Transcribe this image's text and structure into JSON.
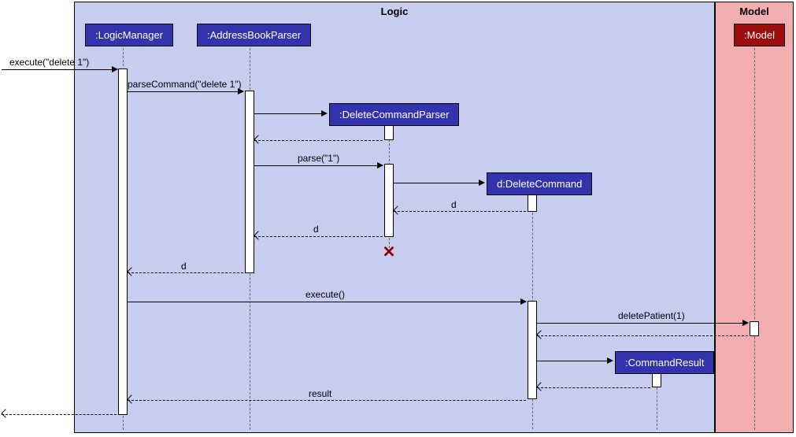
{
  "frames": {
    "logic": {
      "title": "Logic"
    },
    "model": {
      "title": "Model"
    }
  },
  "participants": {
    "logicManager": ":LogicManager",
    "addressBookParser": ":AddressBookParser",
    "deleteCommandParser": ":DeleteCommandParser",
    "deleteCommand": "d:DeleteCommand",
    "commandResult": ":CommandResult",
    "model": ":Model"
  },
  "messages": {
    "execute_delete1": "execute(\"delete 1\")",
    "parseCommand": "parseCommand(\"delete 1\")",
    "parse1": "parse(\"1\")",
    "d_return1": "d",
    "d_return2": "d",
    "d_return3": "d",
    "execute": "execute()",
    "deletePatient": "deletePatient(1)",
    "result": "result"
  },
  "chart_data": {
    "type": "table",
    "diagram_kind": "UML sequence diagram",
    "frames": [
      "Logic",
      "Model"
    ],
    "lifelines": [
      {
        "name": ":LogicManager",
        "frame": "Logic"
      },
      {
        "name": ":AddressBookParser",
        "frame": "Logic"
      },
      {
        "name": ":DeleteCommandParser",
        "frame": "Logic",
        "destroyed": true
      },
      {
        "name": "d:DeleteCommand",
        "frame": "Logic"
      },
      {
        "name": ":CommandResult",
        "frame": "Logic"
      },
      {
        "name": ":Model",
        "frame": "Model"
      }
    ],
    "messages": [
      {
        "from": "(external)",
        "to": ":LogicManager",
        "label": "execute(\"delete 1\")",
        "type": "sync"
      },
      {
        "from": ":LogicManager",
        "to": ":AddressBookParser",
        "label": "parseCommand(\"delete 1\")",
        "type": "sync"
      },
      {
        "from": ":AddressBookParser",
        "to": ":DeleteCommandParser",
        "label": "",
        "type": "create"
      },
      {
        "from": ":DeleteCommandParser",
        "to": ":AddressBookParser",
        "label": "",
        "type": "return"
      },
      {
        "from": ":AddressBookParser",
        "to": ":DeleteCommandParser",
        "label": "parse(\"1\")",
        "type": "sync"
      },
      {
        "from": ":DeleteCommandParser",
        "to": "d:DeleteCommand",
        "label": "",
        "type": "create"
      },
      {
        "from": "d:DeleteCommand",
        "to": ":DeleteCommandParser",
        "label": "d",
        "type": "return"
      },
      {
        "from": ":DeleteCommandParser",
        "to": ":AddressBookParser",
        "label": "d",
        "type": "return"
      },
      {
        "from": ":DeleteCommandParser",
        "to": "(destroy)",
        "label": "X",
        "type": "destroy"
      },
      {
        "from": ":AddressBookParser",
        "to": ":LogicManager",
        "label": "d",
        "type": "return"
      },
      {
        "from": ":LogicManager",
        "to": "d:DeleteCommand",
        "label": "execute()",
        "type": "sync"
      },
      {
        "from": "d:DeleteCommand",
        "to": ":Model",
        "label": "deletePatient(1)",
        "type": "sync"
      },
      {
        "from": ":Model",
        "to": "d:DeleteCommand",
        "label": "",
        "type": "return"
      },
      {
        "from": "d:DeleteCommand",
        "to": ":CommandResult",
        "label": "",
        "type": "create"
      },
      {
        "from": ":CommandResult",
        "to": "d:DeleteCommand",
        "label": "",
        "type": "return"
      },
      {
        "from": "d:DeleteCommand",
        "to": ":LogicManager",
        "label": "result",
        "type": "return"
      },
      {
        "from": ":LogicManager",
        "to": "(external)",
        "label": "",
        "type": "return"
      }
    ]
  }
}
